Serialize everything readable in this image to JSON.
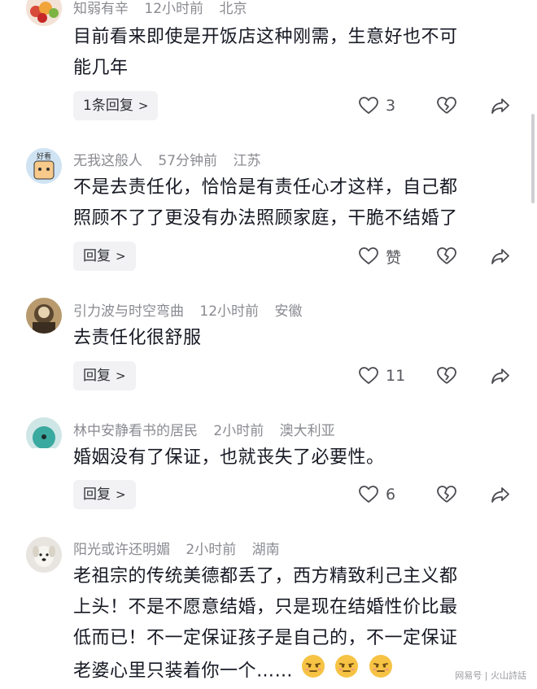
{
  "comments": [
    {
      "username": "知弱有辛",
      "time": "12小时前",
      "location": "北京",
      "text_lines": [
        "目前看来即使是开饭店这种刚需，生意好也不可",
        "能几年"
      ],
      "reply_label": "1条回复",
      "like_count": "3",
      "avatar_icon": "fruit-avatar-icon"
    },
    {
      "username": "无我这般人",
      "time": "57分钟前",
      "location": "江苏",
      "text_lines": [
        "不是去责任化，恰恰是有责任心才这样，自己都",
        "照顾不了了更没有办法照顾家庭，干脆不结婚了"
      ],
      "reply_label": "回复",
      "like_count": "赞",
      "avatar_icon": "cartoon-avatar-icon"
    },
    {
      "username": "引力波与时空弯曲",
      "time": "12小时前",
      "location": "安徽",
      "text_lines": [
        "去责任化很舒服"
      ],
      "reply_label": "回复",
      "like_count": "11",
      "avatar_icon": "photo-avatar-icon"
    },
    {
      "username": "林中安静看书的居民",
      "time": "2小时前",
      "location": "澳大利亚",
      "text_lines": [
        "婚姻没有了保证，也就丧失了必要性。"
      ],
      "reply_label": "回复",
      "like_count": "6",
      "avatar_icon": "teal-bird-avatar-icon"
    },
    {
      "username": "阳光或许还明媚",
      "time": "2小时前",
      "location": "湖南",
      "text_lines": [
        "老祖宗的传统美德都丢了，西方精致利己主义都",
        "上头！不是不愿意结婚，只是现在结婚性价比最",
        "低而已！不一定保证孩子是自己的，不一定保证",
        "老婆心里只装着你一个……"
      ],
      "reply_label": "",
      "like_count": "",
      "avatar_icon": "dog-avatar-icon"
    }
  ],
  "avatar_text_2": "好看",
  "emojis": [
    "annoyed-emoji-icon",
    "annoyed-emoji-icon",
    "annoyed-emoji-icon"
  ],
  "watermark": "网易号 | 火山詩話",
  "colors": {
    "text": "#161823",
    "meta": "#8a8b91",
    "reply_bg": "#f2f2f4"
  }
}
